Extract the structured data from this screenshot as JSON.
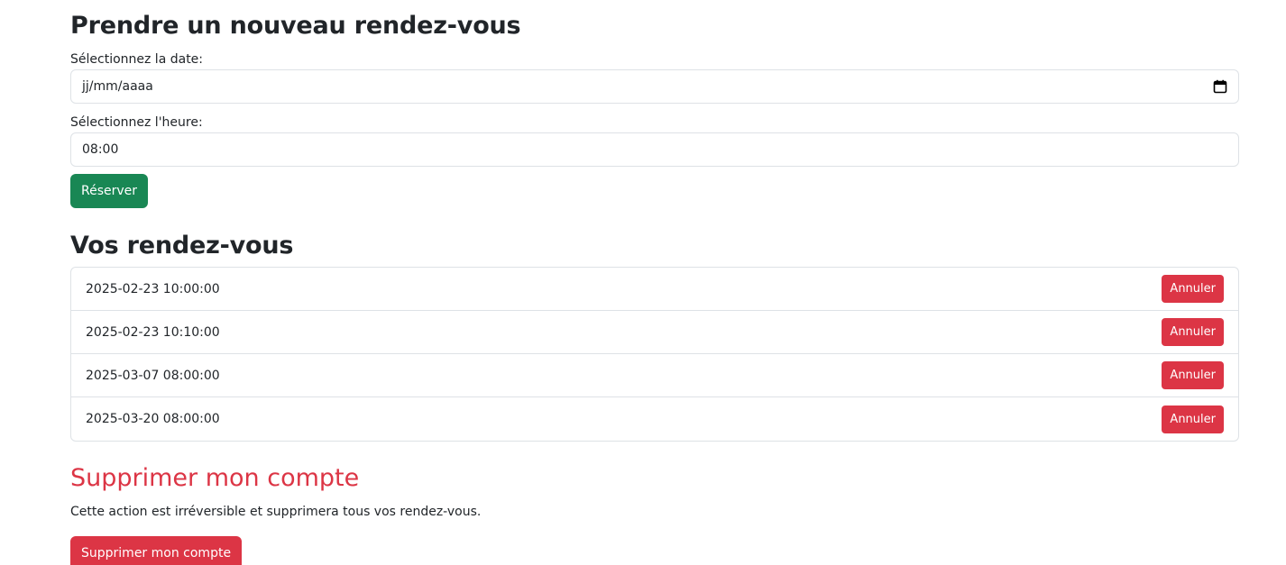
{
  "booking": {
    "title": "Prendre un nouveau rendez-vous",
    "date_label": "Sélectionnez la date:",
    "date_placeholder": "jj/mm/aaaa",
    "time_label": "Sélectionnez l'heure:",
    "time_value": "08:00",
    "submit_label": "Réserver"
  },
  "appointments": {
    "title": "Vos rendez-vous",
    "cancel_label": "Annuler",
    "items": [
      {
        "datetime": "2025-02-23 10:00:00"
      },
      {
        "datetime": "2025-02-23 10:10:00"
      },
      {
        "datetime": "2025-03-07 08:00:00"
      },
      {
        "datetime": "2025-03-20 08:00:00"
      }
    ]
  },
  "delete_account": {
    "title": "Supprimer mon compte",
    "warning": "Cette action est irréversible et supprimera tous vos rendez-vous.",
    "button_label": "Supprimer mon compte"
  },
  "colors": {
    "success": "#198754",
    "danger": "#dc3545",
    "border": "#dee2e6",
    "text": "#212529"
  },
  "icons": {
    "date_picker": "calendar-icon"
  }
}
